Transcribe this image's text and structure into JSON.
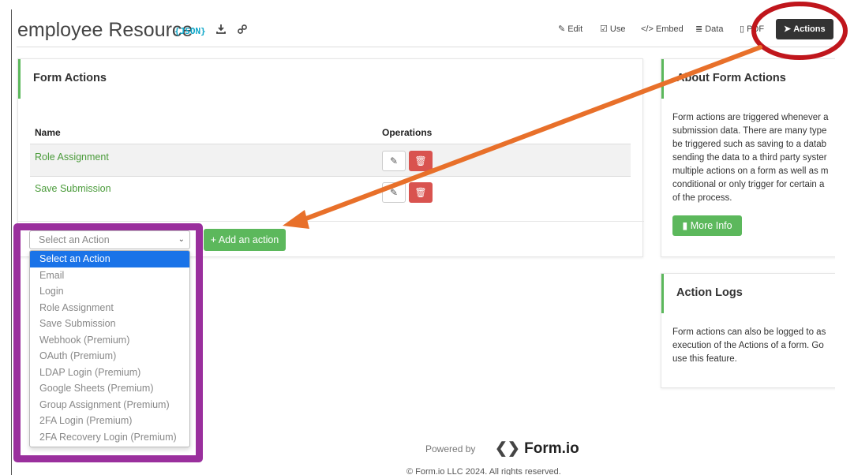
{
  "header": {
    "title": "employee Resource",
    "json_badge": "{JSON}",
    "tabs": [
      {
        "label": "Edit",
        "icon": "edit-icon"
      },
      {
        "label": "Use",
        "icon": "check-square-icon"
      },
      {
        "label": "Embed",
        "icon": "code-icon"
      },
      {
        "label": "Data",
        "icon": "database-icon"
      },
      {
        "label": "PDF",
        "icon": "file-pdf-icon"
      },
      {
        "label": "Actions",
        "icon": "paper-plane-icon"
      }
    ]
  },
  "form_actions": {
    "title": "Form Actions",
    "columns": [
      "Name",
      "Operations"
    ],
    "rows": [
      {
        "name": "Role Assignment"
      },
      {
        "name": "Save Submission"
      }
    ],
    "select_placeholder": "Select an Action",
    "add_label": "Add an action",
    "options": [
      "Select an Action",
      "Email",
      "Login",
      "Role Assignment",
      "Save Submission",
      "Webhook (Premium)",
      "OAuth (Premium)",
      "LDAP Login (Premium)",
      "Google Sheets (Premium)",
      "Group Assignment (Premium)",
      "2FA Login (Premium)",
      "2FA Recovery Login (Premium)"
    ]
  },
  "about": {
    "title": "About Form Actions",
    "lines": [
      "Form actions are triggered whenever a",
      "submission data. There are many type",
      "be triggered such as saving to a datab",
      "sending the data to a third party syster",
      "multiple actions on a form as well as m",
      "conditional or only trigger for certain a",
      "of the process."
    ],
    "more_info_label": "More Info"
  },
  "logs": {
    "title": "Action Logs",
    "lines": [
      "Form actions can also be logged to as",
      "execution of the Actions of a form. Go",
      "use this feature."
    ]
  },
  "footer": {
    "powered_by": "Powered by",
    "brand": "Form.io",
    "copyright": "© Form.io LLC 2024. All rights reserved."
  },
  "colors": {
    "accent_green": "#5cb85c",
    "danger_red": "#d9534f",
    "annotation_orange": "#e8702a",
    "annotation_red": "#c0161c",
    "annotation_purple": "#9a2f9d",
    "selected_blue": "#1a73e8"
  }
}
